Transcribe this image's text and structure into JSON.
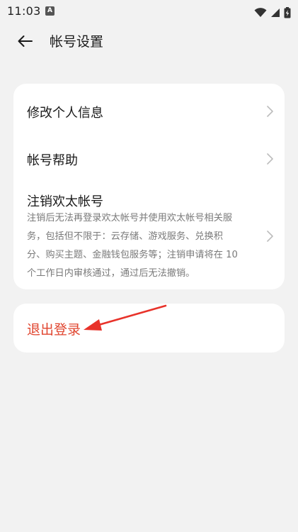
{
  "status_bar": {
    "time": "11:03",
    "notif_glyph": "A",
    "icons": [
      "wifi-icon",
      "signal-icon",
      "battery-charging-icon"
    ]
  },
  "header": {
    "title": "帐号设置",
    "back_icon": "back-arrow-icon"
  },
  "settings": {
    "items": [
      {
        "label": "修改个人信息"
      },
      {
        "label": "帐号帮助"
      },
      {
        "label": "注销欢太帐号",
        "desc_lines": [
          "注销后无法再登录欢太帐号并使用欢太帐号相关服",
          "务，包括但不限于：云存储、游戏服务、兑换积",
          "分、购买主题、金融钱包服务等；注销申请将在 10",
          "个工作日内审核通过，通过后无法撤销。"
        ]
      }
    ]
  },
  "logout": {
    "label": "退出登录"
  },
  "colors": {
    "background": "#f2f2f2",
    "card": "#ffffff",
    "logout_text": "#e0452f",
    "annotation_arrow": "#e8322a"
  }
}
